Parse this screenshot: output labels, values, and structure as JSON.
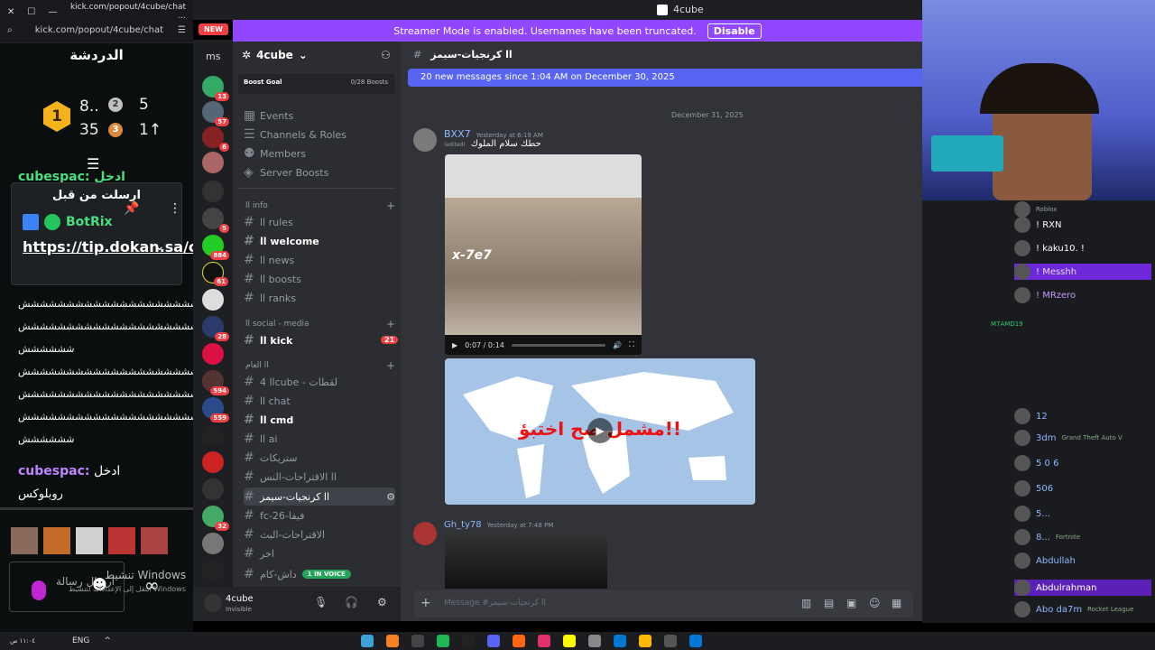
{
  "browser": {
    "url_title": "kick.com/popout/4cube/chat ...",
    "url": "kick.com/popout/4cube/chat"
  },
  "kick": {
    "title": "الدردشة",
    "leaderboard": {
      "first": "1",
      "first_val": "8..",
      "second": "2",
      "second_val": "5",
      "third": "3",
      "third_val": "35",
      "fourth_val": "1↑"
    },
    "truncated_user": "cubespac: ادخل",
    "pinned": {
      "header": "ارسلت من قبل",
      "bot": "BotRix",
      "link": "https://tip.dokan.sa/cubes..."
    },
    "lines": [
      "ششششششششششششششششششششش",
      "ششششششششششششششششششششش",
      "شششششش",
      "ششششششششششششششششششششش",
      "ششششششششششششششششششششش",
      "ششششششششششششششششششششش",
      "شششششش"
    ],
    "last_user": "cubespac:",
    "last_text1": "ادخل",
    "last_text2": "روبلوكس",
    "send": "ارسال رسالة",
    "activate_windows": "تنشيط Windows",
    "activate_windows_sub": "انتقل إلى الإعدادات لتنشيط Windows."
  },
  "discord": {
    "window_title": "4cube",
    "new_label": "NEW",
    "streamer_mode": "Streamer Mode is enabled. Usernames have been truncated.",
    "disable": "Disable",
    "server_name": "4cube",
    "boost_goal": "Boost Goal",
    "boosts": "0/28 Boosts",
    "menu": [
      "Events",
      "Channels & Roles",
      "Members",
      "Server Boosts"
    ],
    "cat_info": "اا info",
    "ch_rules": "اا rules",
    "ch_welcome": "اا welcome",
    "ch_news": "اا news",
    "ch_boosts": "اا boosts",
    "ch_ranks": "اا ranks",
    "cat_social": "اا social - media",
    "ch_kick": "اا kick",
    "kick_badge": "21",
    "cat_general": "اا العام",
    "ch_4cube": "اا 4cube - لقطات",
    "ch_chat": "اا chat",
    "ch_cmd": "اا cmd",
    "ch_ai": "اا ai",
    "ch_streak": "ستريكات",
    "ch_sugg": "اا الاقتراحات-النس",
    "ch_selected": "اا كرنجيات-سيمز",
    "ch_fc": "fc-26-فيفا",
    "ch_sug2": "الاقتراحات-البث",
    "ch_other": "اخر",
    "ch_voice": "داش-كام",
    "voice_badge": "1 IN VOICE",
    "username": "4cube",
    "user_status": "Invisible",
    "channel_header": "اا كرنجيات-سيمز",
    "new_msgs": "20 new messages since 1:04 AM on December 30, 2025",
    "date_div": "December 31, 2025",
    "msg1_user": "BXX7",
    "msg1_time": "Yesterday at 6:19 AM",
    "msg1_edited": "(edited)",
    "msg1_text": "حطك سلام الملوك",
    "video_caption": "x-7e7",
    "video_time": "0:07 / 0:14",
    "map_text": "مشمل صح اختبؤ!!",
    "msg2_user": "Gh_ty78",
    "msg2_time": "Yesterday at 7:48 PM",
    "composer": "Message #اا كرنجيات-سيمز",
    "rail_ms": "ms",
    "rail_badges": [
      "13",
      "57",
      "6",
      "5",
      "884",
      "61",
      "28",
      "594",
      "559",
      "32"
    ]
  },
  "stream_chat": [
    {
      "name": "Roblox",
      "color": "#9aa0a6"
    },
    {
      "name": "! RXN",
      "color": "#ffffff"
    },
    {
      "name": "! kaku10. !",
      "color": "#ffffff"
    },
    {
      "name": "! Messhh",
      "color": "#c39bff"
    },
    {
      "name": "! MRzero",
      "color": "#c39bff"
    },
    {
      "name": "M7AMD19",
      "color": "#8fb7ff"
    },
    {
      "name": "12",
      "color": "#8fb7ff"
    },
    {
      "name": "3dm",
      "color": "#8fb7ff"
    },
    {
      "name": "5 0 6",
      "color": "#8fb7ff"
    },
    {
      "name": "506",
      "color": "#8fb7ff"
    },
    {
      "name": "5...",
      "color": "#8fb7ff"
    },
    {
      "name": "8...",
      "color": "#8fb7ff"
    },
    {
      "name": "Abdullah",
      "color": "#8fb7ff"
    },
    {
      "name": "Abdulrahman",
      "color": "#8fb7ff"
    },
    {
      "name": "Abo da7m",
      "color": "#8fb7ff"
    }
  ],
  "stream_sub": {
    "gta": "Grand Theft Auto V",
    "fortnite": "Fortnite",
    "rocket": "Rocket League"
  },
  "taskbar": {
    "lang": "ENG",
    "time": "١١:٠٤ ص",
    "date": "٢٧/١٢/٣١"
  }
}
